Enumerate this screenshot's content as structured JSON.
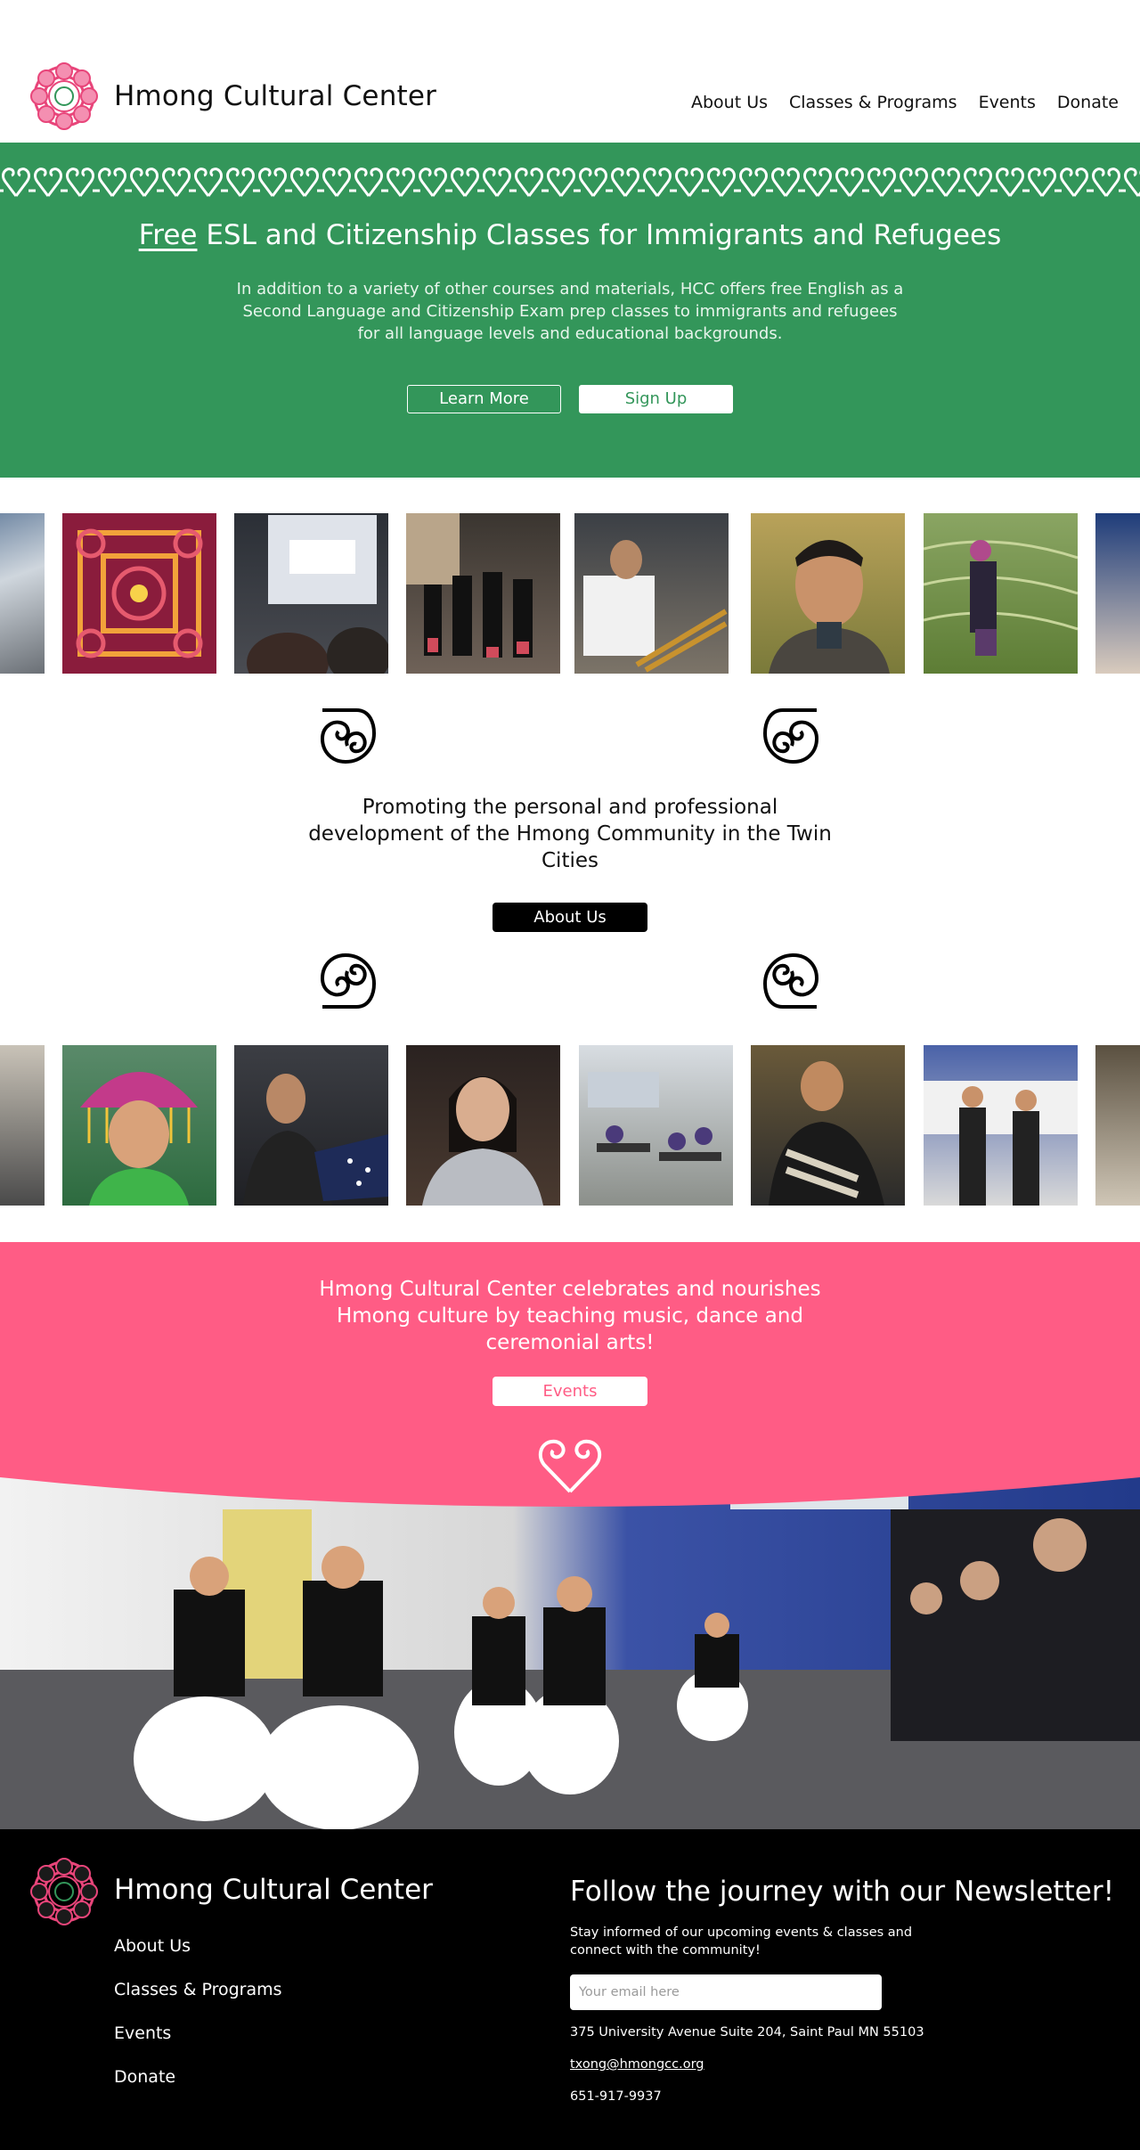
{
  "header": {
    "brand": "Hmong Cultural Center",
    "nav": [
      "About Us",
      "Classes & Programs",
      "Events",
      "Donate"
    ]
  },
  "hero": {
    "title_free": "Free",
    "title_rest": " ESL and Citizenship Classes for Immigrants and Refugees",
    "body": "In addition to a variety of other courses and materials, HCC offers free English as a Second Language and Citizenship Exam prep classes to immigrants and refugees for all language levels and educational backgrounds.",
    "learn_more": "Learn More",
    "sign_up": "Sign Up"
  },
  "mission": {
    "text": "Promoting the personal and professional development of the Hmong Community in the Twin Cities",
    "button": "About Us"
  },
  "culture": {
    "text": "Hmong Cultural Center celebrates and nourishes Hmong culture by teaching music, dance and ceremonial arts!",
    "button": "Events"
  },
  "footer": {
    "brand": "Hmong Cultural Center",
    "links": [
      "About Us",
      "Classes & Programs",
      "Events",
      "Donate"
    ],
    "newsletter_title": "Follow the journey with our Newsletter!",
    "newsletter_desc": "Stay informed of our upcoming events & classes and connect with the community!",
    "email_placeholder": "Your email here",
    "address": "375 University Avenue Suite 204, Saint Paul MN 55103",
    "email": "txong@hmongcc.org",
    "phone": "651-917-9937"
  },
  "colors": {
    "green": "#33965a",
    "pink": "#ff5c85",
    "black": "#000000"
  }
}
